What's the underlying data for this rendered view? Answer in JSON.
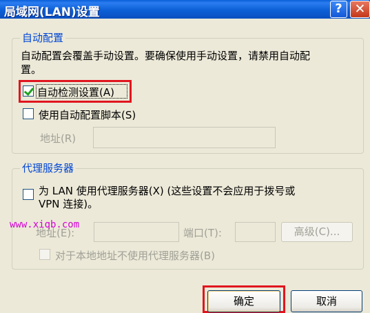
{
  "window": {
    "title": "局域网(LAN)设置",
    "help_glyph": "?",
    "close_glyph": "✕"
  },
  "auto_config": {
    "group_title": "自动配置",
    "description_line1": "自动配置会覆盖手动设置。要确保使用手动设置，请禁用自动配",
    "description_line2": "置。",
    "auto_detect_label": "自动检测设置(A)",
    "auto_detect_checked": true,
    "script_label": "使用自动配置脚本(S)",
    "script_checked": false,
    "address_label": "地址(R)",
    "address_value": ""
  },
  "proxy": {
    "group_title": "代理服务器",
    "use_proxy_line1": "为 LAN 使用代理服务器(X) (这些设置不会应用于拨号或",
    "use_proxy_line2": "VPN 连接)。",
    "use_proxy_checked": false,
    "address_label": "地址(E):",
    "address_value": "",
    "port_label": "端口(T):",
    "port_value": "",
    "advanced_label": "高级(C)...",
    "bypass_label": "对于本地地址不使用代理服务器(B)",
    "bypass_checked": false
  },
  "buttons": {
    "ok_label": "确定",
    "cancel_label": "取消"
  },
  "watermark": "www.xiqb.com",
  "colors": {
    "titlebar": "#0a5fd8",
    "group_title": "#0046d5",
    "highlight_box": "#e1141e",
    "check": "#21a121",
    "watermark": "#d400d4"
  }
}
